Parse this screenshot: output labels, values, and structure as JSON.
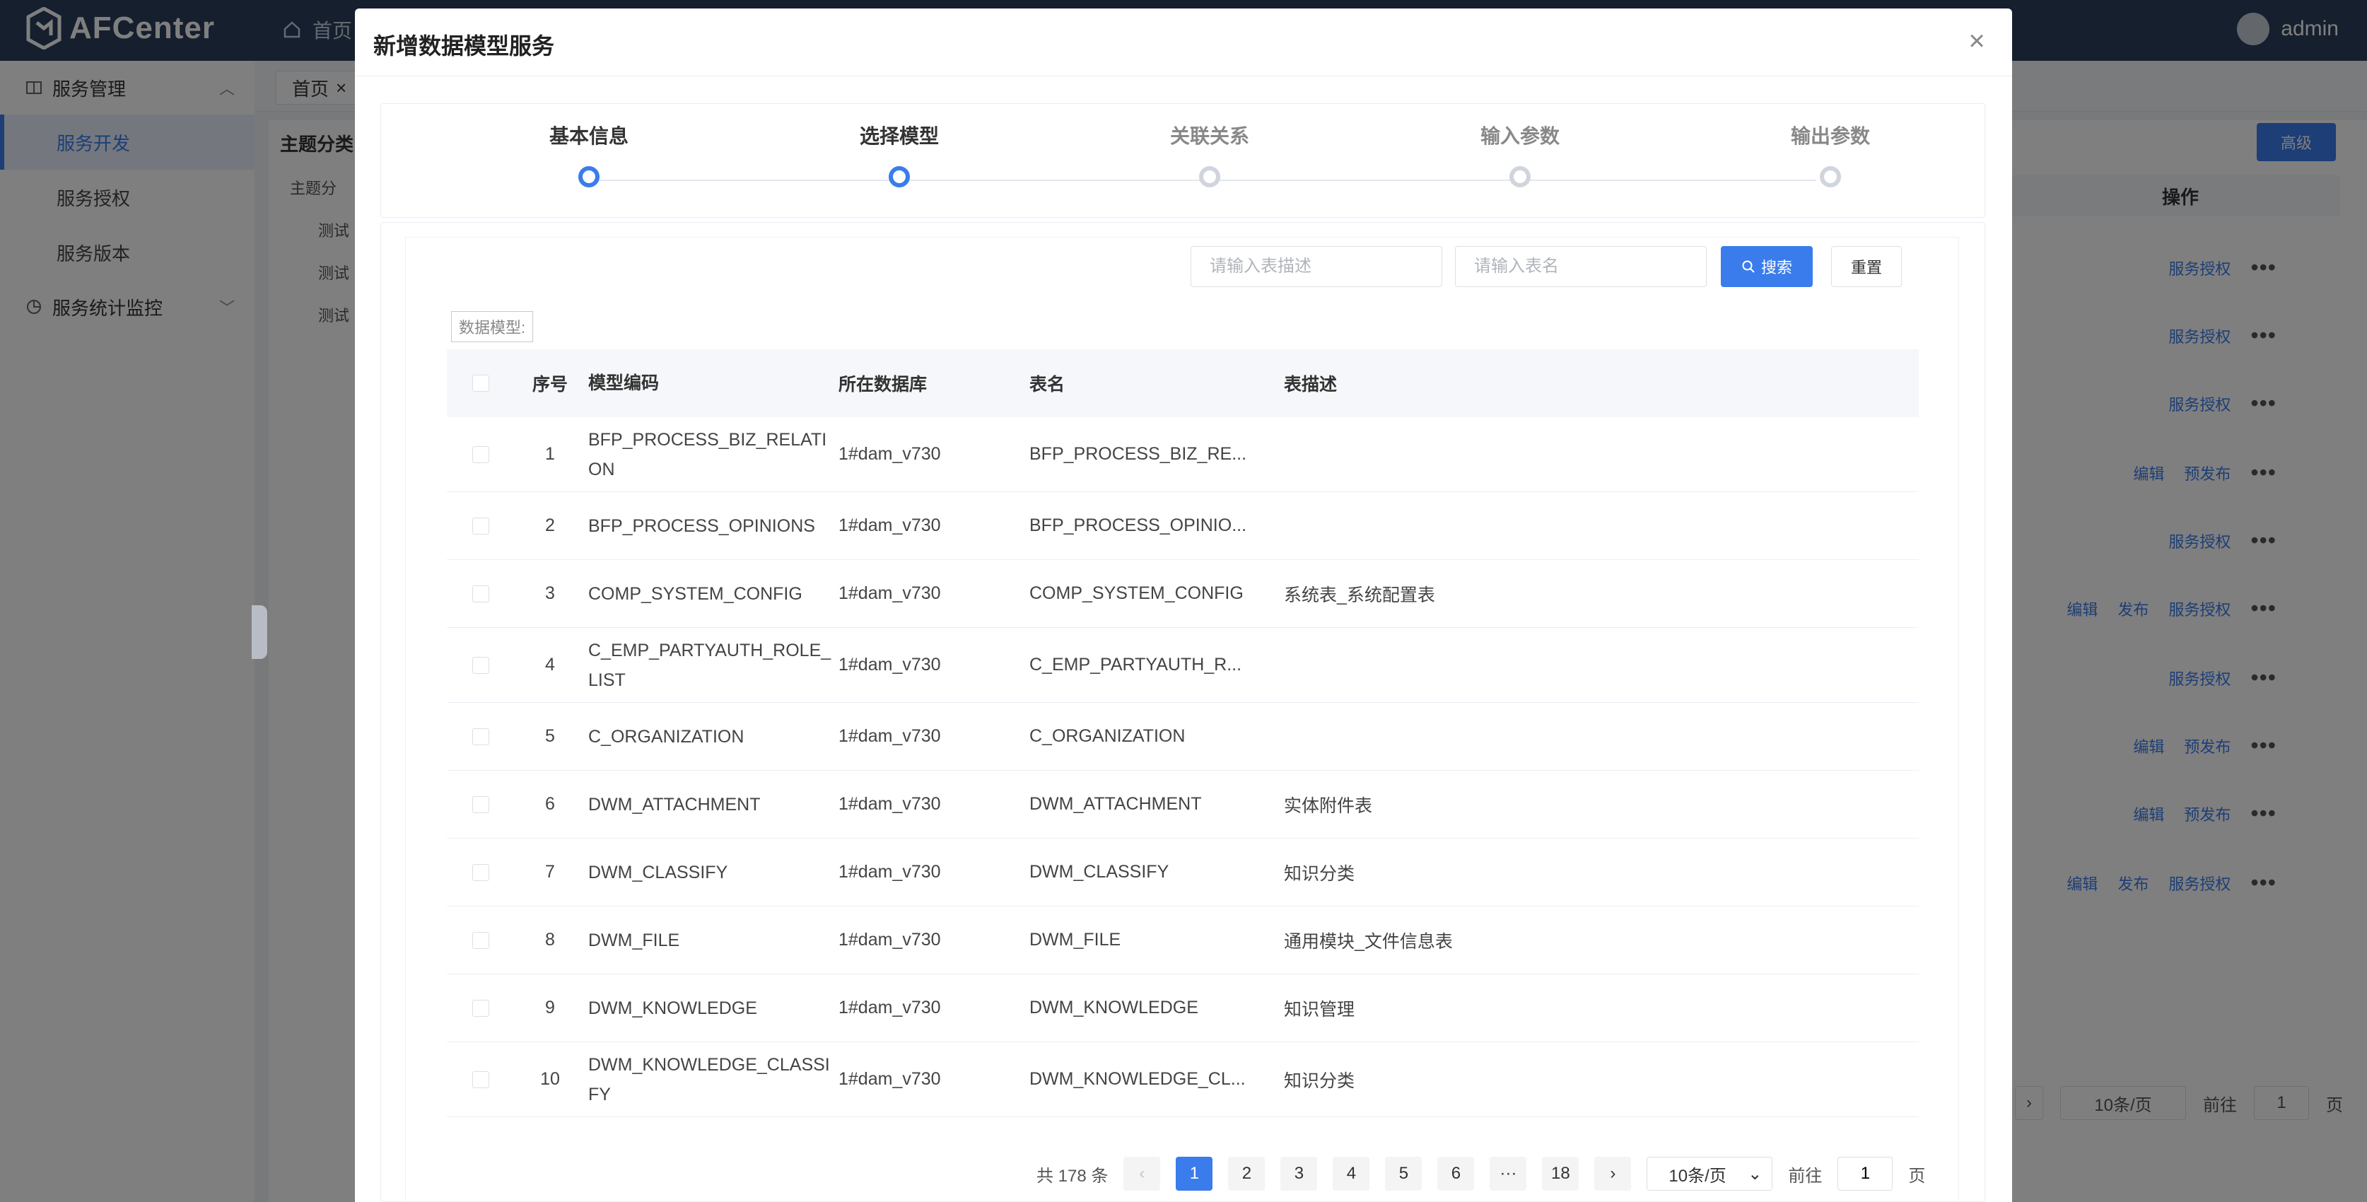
{
  "app": {
    "name": "AFCenter",
    "home_label": "首页",
    "user": "admin"
  },
  "sidebar": {
    "group1": "服务管理",
    "items": [
      "服务开发",
      "服务授权",
      "服务版本"
    ],
    "group2": "服务统计监控"
  },
  "tabs": {
    "home": "首页",
    "close": "×"
  },
  "tree": {
    "title": "主题分类",
    "root": "主题分",
    "children": [
      "测试",
      "测试",
      "测试"
    ]
  },
  "background_right": {
    "advanced": "高级",
    "op_header": "操作",
    "rows": [
      [
        "服务授权"
      ],
      [
        "服务授权"
      ],
      [
        "服务授权"
      ],
      [
        "编辑",
        "预发布"
      ],
      [
        "服务授权"
      ],
      [
        "编辑",
        "发布",
        "服务授权"
      ],
      [
        "服务授权"
      ],
      [
        "编辑",
        "预发布"
      ],
      [
        "编辑",
        "预发布"
      ],
      [
        "编辑",
        "发布",
        "服务授权"
      ]
    ],
    "more": "•••",
    "page_size": "10条/页",
    "goto_label": "前往",
    "goto_value": "1",
    "page_unit": "页"
  },
  "modal": {
    "title": "新增数据模型服务",
    "close": "×",
    "steps": [
      {
        "label": "基本信息",
        "state": "done"
      },
      {
        "label": "选择模型",
        "state": "active"
      },
      {
        "label": "关联关系",
        "state": "pending"
      },
      {
        "label": "输入参数",
        "state": "pending"
      },
      {
        "label": "输出参数",
        "state": "pending"
      }
    ],
    "search": {
      "desc_placeholder": "请输入表描述",
      "name_placeholder": "请输入表名",
      "search_btn": "搜索",
      "reset_btn": "重置"
    },
    "model_tag": "数据模型:",
    "table": {
      "headers": {
        "idx": "序号",
        "code": "模型编码",
        "db": "所在数据库",
        "tbl": "表名",
        "desc": "表描述"
      },
      "rows": [
        {
          "idx": "1",
          "code": "BFP_PROCESS_BIZ_RELATION",
          "db": "1#dam_v730",
          "tbl": "BFP_PROCESS_BIZ_RE...",
          "desc": ""
        },
        {
          "idx": "2",
          "code": "BFP_PROCESS_OPINIONS",
          "db": "1#dam_v730",
          "tbl": "BFP_PROCESS_OPINIO...",
          "desc": ""
        },
        {
          "idx": "3",
          "code": "COMP_SYSTEM_CONFIG",
          "db": "1#dam_v730",
          "tbl": "COMP_SYSTEM_CONFIG",
          "desc": "系统表_系统配置表"
        },
        {
          "idx": "4",
          "code": "C_EMP_PARTYAUTH_ROLE_LIST",
          "db": "1#dam_v730",
          "tbl": "C_EMP_PARTYAUTH_R...",
          "desc": ""
        },
        {
          "idx": "5",
          "code": "C_ORGANIZATION",
          "db": "1#dam_v730",
          "tbl": "C_ORGANIZATION",
          "desc": ""
        },
        {
          "idx": "6",
          "code": "DWM_ATTACHMENT",
          "db": "1#dam_v730",
          "tbl": "DWM_ATTACHMENT",
          "desc": "实体附件表"
        },
        {
          "idx": "7",
          "code": "DWM_CLASSIFY",
          "db": "1#dam_v730",
          "tbl": "DWM_CLASSIFY",
          "desc": "知识分类"
        },
        {
          "idx": "8",
          "code": "DWM_FILE",
          "db": "1#dam_v730",
          "tbl": "DWM_FILE",
          "desc": "通用模块_文件信息表"
        },
        {
          "idx": "9",
          "code": "DWM_KNOWLEDGE",
          "db": "1#dam_v730",
          "tbl": "DWM_KNOWLEDGE",
          "desc": "知识管理"
        },
        {
          "idx": "10",
          "code": "DWM_KNOWLEDGE_CLASSIFY",
          "db": "1#dam_v730",
          "tbl": "DWM_KNOWLEDGE_CL...",
          "desc": "知识分类"
        }
      ]
    },
    "pager": {
      "total": "共 178 条",
      "prev": "‹",
      "pages": [
        "1",
        "2",
        "3",
        "4",
        "5",
        "6",
        "···",
        "18"
      ],
      "active": "1",
      "next": "›",
      "page_size": "10条/页",
      "goto_label": "前往",
      "goto_value": "1",
      "page_unit": "页"
    }
  },
  "colors": {
    "primary": "#3a7cec",
    "topbar": "#2c3e5c"
  }
}
